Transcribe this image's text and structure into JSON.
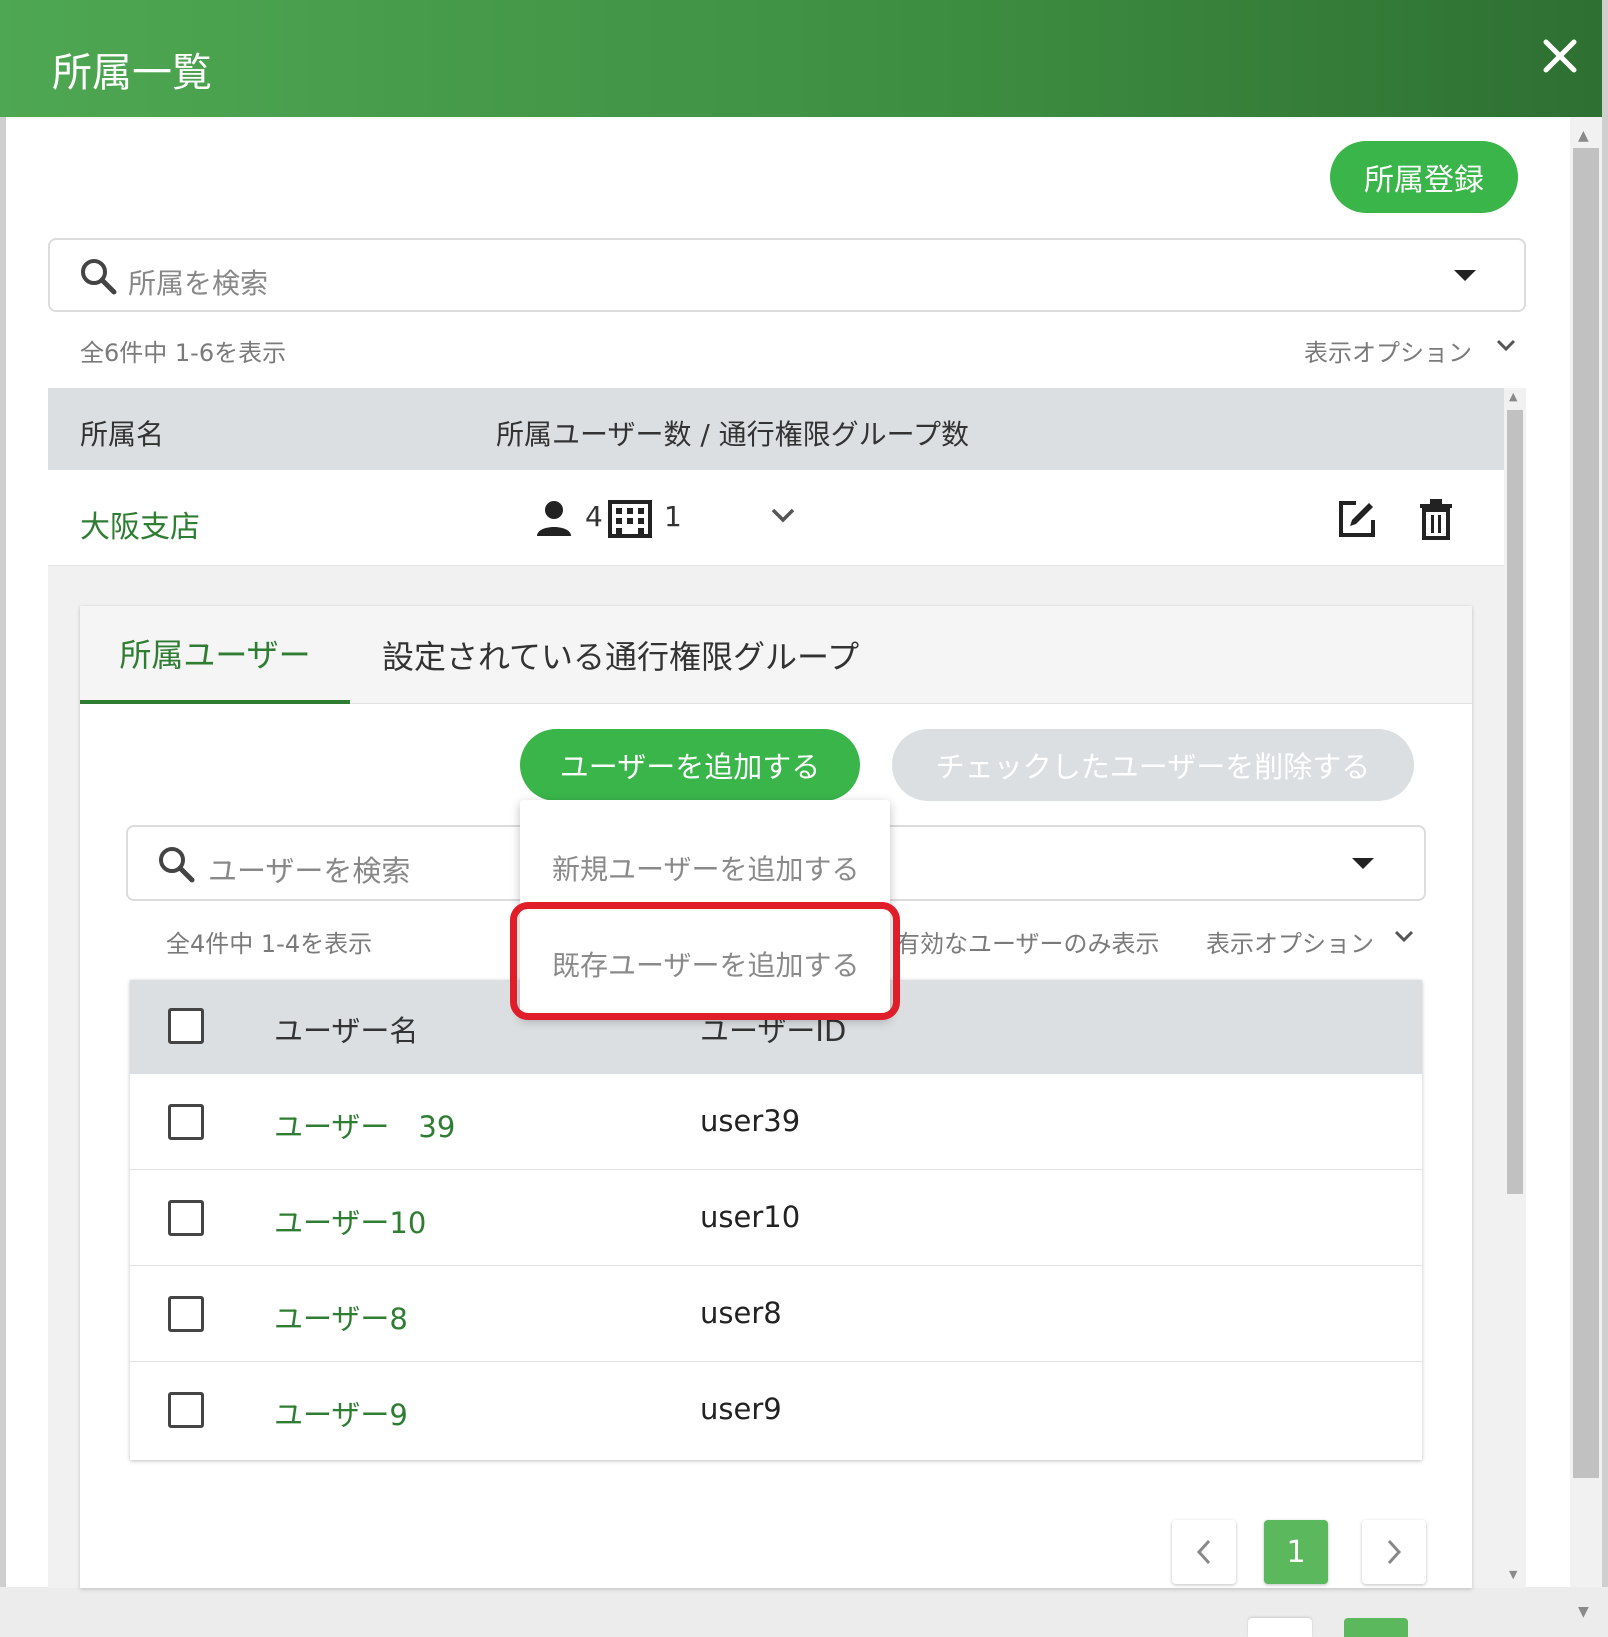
{
  "header": {
    "title": "所属一覧"
  },
  "toolbar": {
    "register_label": "所属登録"
  },
  "search": {
    "placeholder": "所属を検索"
  },
  "list": {
    "count_text": "全6件中 1-6を表示",
    "display_options": "表示オプション",
    "columns": [
      "所属名",
      "所属ユーザー数 / 通行権限グループ数"
    ],
    "rows": [
      {
        "name": "大阪支店",
        "user_count": "4",
        "group_count": "1"
      }
    ]
  },
  "detail": {
    "tabs": [
      {
        "label": "所属ユーザー",
        "active": true
      },
      {
        "label": "設定されている通行権限グループ",
        "active": false
      }
    ],
    "add_user_label": "ユーザーを追加する",
    "delete_checked_label": "チェックしたユーザーを削除する",
    "user_search_placeholder": "ユーザーを検索",
    "count_text": "全4件中 1-4を表示",
    "valid_only_text": "有効なユーザーのみ表示",
    "display_options": "表示オプション",
    "columns": [
      "ユーザー名",
      "ユーザーID"
    ],
    "users": [
      {
        "name": "ユーザー　39",
        "id": "user39"
      },
      {
        "name": "ユーザー10",
        "id": "user10"
      },
      {
        "name": "ユーザー8",
        "id": "user8"
      },
      {
        "name": "ユーザー9",
        "id": "user9"
      }
    ],
    "pagination": {
      "current": "1"
    }
  },
  "dropdown": {
    "items": [
      "新規ユーザーを追加する",
      "既存ユーザーを追加する"
    ],
    "highlighted_index": 1
  },
  "colors": {
    "header_green": "#3d8d41",
    "button_green": "#3ab54a",
    "link_green": "#2e7d32",
    "highlight_red": "#e01e2a"
  }
}
